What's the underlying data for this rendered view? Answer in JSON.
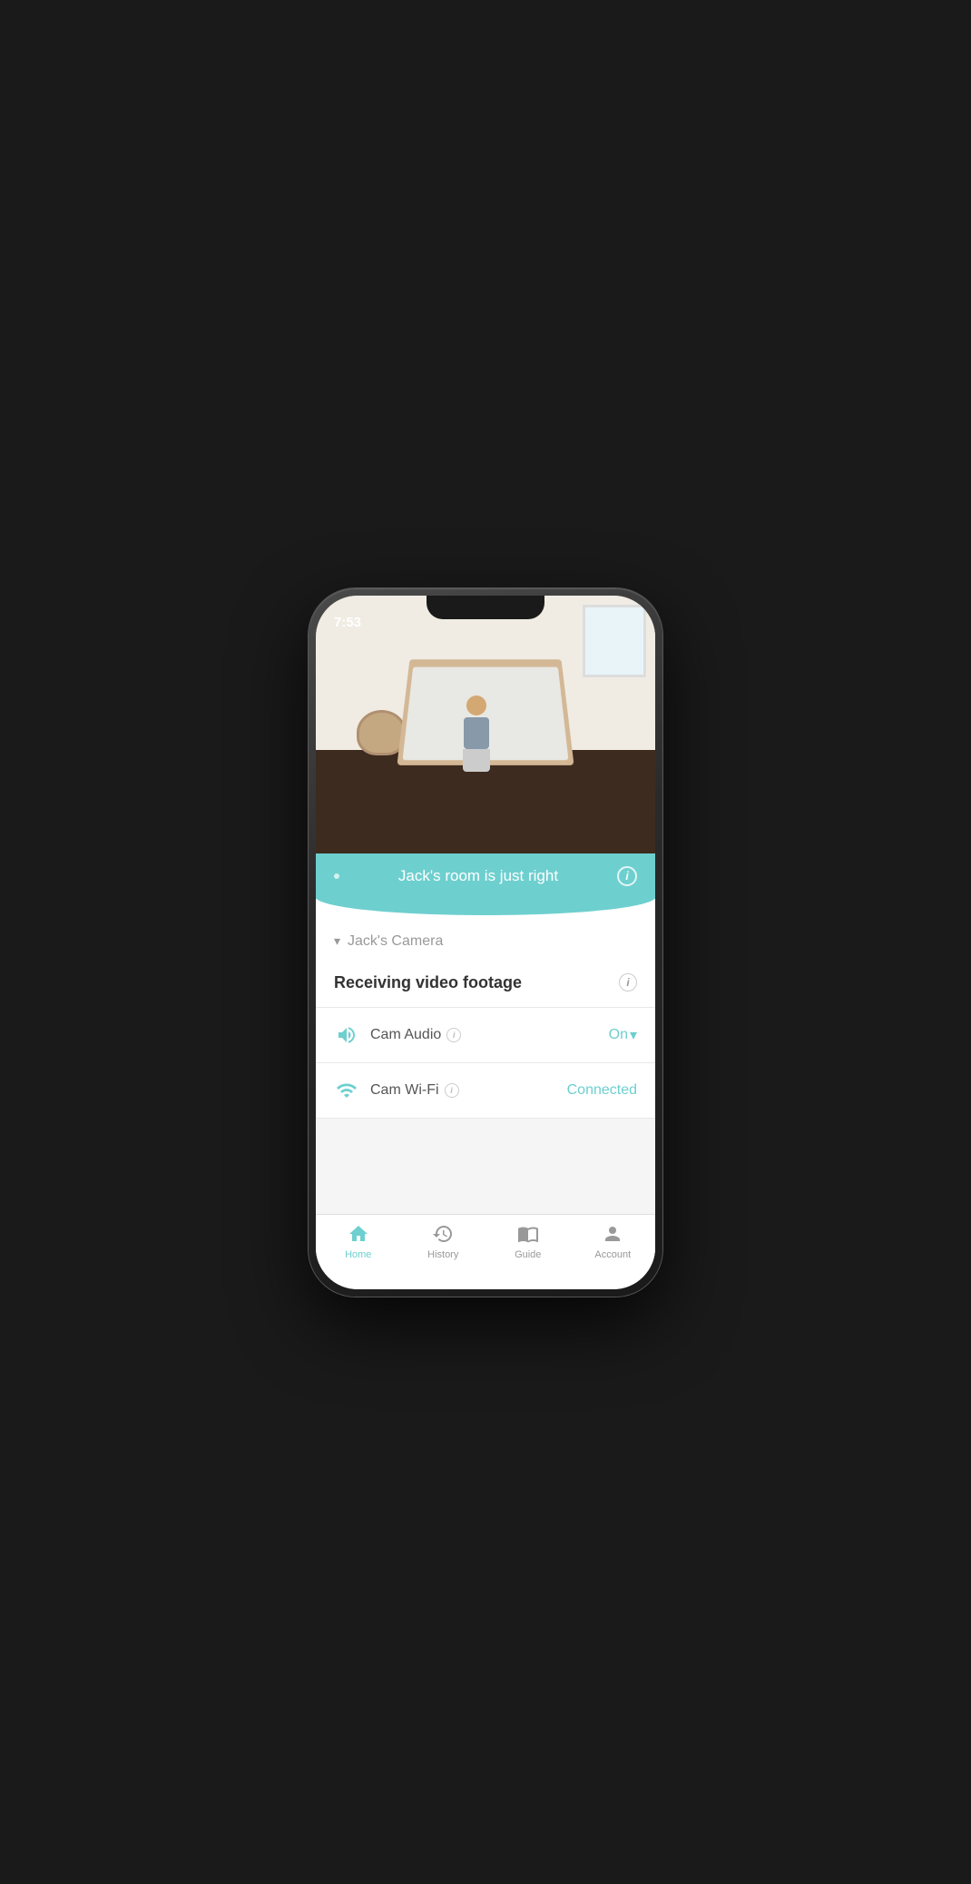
{
  "statusBar": {
    "time": "7:53"
  },
  "cameraBanner": {
    "statusText": "Jack's room is just right",
    "infoLabel": "i"
  },
  "cameraSection": {
    "cameraName": "Jack's Camera",
    "chevron": "▾"
  },
  "videoStatus": {
    "text": "Receiving video footage",
    "infoLabel": "i"
  },
  "camAudio": {
    "label": "Cam Audio",
    "value": "On",
    "dropdown": "▾",
    "infoLabel": "i"
  },
  "camWifi": {
    "label": "Cam Wi-Fi",
    "value": "Connected",
    "infoLabel": "i"
  },
  "tabBar": {
    "home": "Home",
    "history": "History",
    "guide": "Guide",
    "account": "Account"
  },
  "accentColor": "#6ecfcf"
}
